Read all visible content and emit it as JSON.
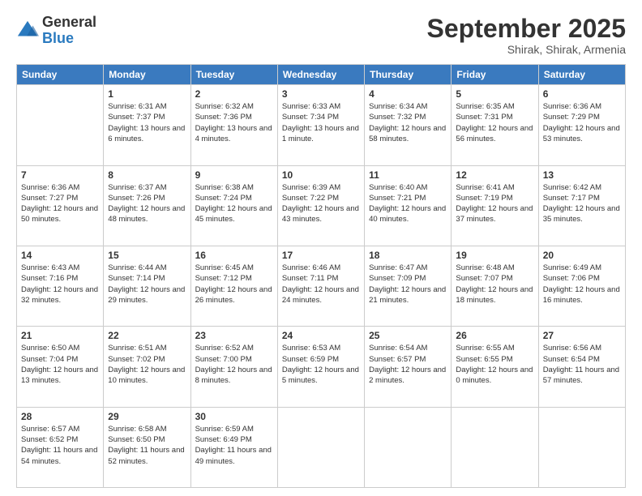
{
  "logo": {
    "general": "General",
    "blue": "Blue"
  },
  "header": {
    "month": "September 2025",
    "location": "Shirak, Shirak, Armenia"
  },
  "weekdays": [
    "Sunday",
    "Monday",
    "Tuesday",
    "Wednesday",
    "Thursday",
    "Friday",
    "Saturday"
  ],
  "weeks": [
    [
      null,
      {
        "day": "1",
        "sunrise": "6:31 AM",
        "sunset": "7:37 PM",
        "daylight": "13 hours and 6 minutes."
      },
      {
        "day": "2",
        "sunrise": "6:32 AM",
        "sunset": "7:36 PM",
        "daylight": "13 hours and 4 minutes."
      },
      {
        "day": "3",
        "sunrise": "6:33 AM",
        "sunset": "7:34 PM",
        "daylight": "13 hours and 1 minute."
      },
      {
        "day": "4",
        "sunrise": "6:34 AM",
        "sunset": "7:32 PM",
        "daylight": "12 hours and 58 minutes."
      },
      {
        "day": "5",
        "sunrise": "6:35 AM",
        "sunset": "7:31 PM",
        "daylight": "12 hours and 56 minutes."
      },
      {
        "day": "6",
        "sunrise": "6:36 AM",
        "sunset": "7:29 PM",
        "daylight": "12 hours and 53 minutes."
      }
    ],
    [
      {
        "day": "7",
        "sunrise": "6:36 AM",
        "sunset": "7:27 PM",
        "daylight": "12 hours and 50 minutes."
      },
      {
        "day": "8",
        "sunrise": "6:37 AM",
        "sunset": "7:26 PM",
        "daylight": "12 hours and 48 minutes."
      },
      {
        "day": "9",
        "sunrise": "6:38 AM",
        "sunset": "7:24 PM",
        "daylight": "12 hours and 45 minutes."
      },
      {
        "day": "10",
        "sunrise": "6:39 AM",
        "sunset": "7:22 PM",
        "daylight": "12 hours and 43 minutes."
      },
      {
        "day": "11",
        "sunrise": "6:40 AM",
        "sunset": "7:21 PM",
        "daylight": "12 hours and 40 minutes."
      },
      {
        "day": "12",
        "sunrise": "6:41 AM",
        "sunset": "7:19 PM",
        "daylight": "12 hours and 37 minutes."
      },
      {
        "day": "13",
        "sunrise": "6:42 AM",
        "sunset": "7:17 PM",
        "daylight": "12 hours and 35 minutes."
      }
    ],
    [
      {
        "day": "14",
        "sunrise": "6:43 AM",
        "sunset": "7:16 PM",
        "daylight": "12 hours and 32 minutes."
      },
      {
        "day": "15",
        "sunrise": "6:44 AM",
        "sunset": "7:14 PM",
        "daylight": "12 hours and 29 minutes."
      },
      {
        "day": "16",
        "sunrise": "6:45 AM",
        "sunset": "7:12 PM",
        "daylight": "12 hours and 26 minutes."
      },
      {
        "day": "17",
        "sunrise": "6:46 AM",
        "sunset": "7:11 PM",
        "daylight": "12 hours and 24 minutes."
      },
      {
        "day": "18",
        "sunrise": "6:47 AM",
        "sunset": "7:09 PM",
        "daylight": "12 hours and 21 minutes."
      },
      {
        "day": "19",
        "sunrise": "6:48 AM",
        "sunset": "7:07 PM",
        "daylight": "12 hours and 18 minutes."
      },
      {
        "day": "20",
        "sunrise": "6:49 AM",
        "sunset": "7:06 PM",
        "daylight": "12 hours and 16 minutes."
      }
    ],
    [
      {
        "day": "21",
        "sunrise": "6:50 AM",
        "sunset": "7:04 PM",
        "daylight": "12 hours and 13 minutes."
      },
      {
        "day": "22",
        "sunrise": "6:51 AM",
        "sunset": "7:02 PM",
        "daylight": "12 hours and 10 minutes."
      },
      {
        "day": "23",
        "sunrise": "6:52 AM",
        "sunset": "7:00 PM",
        "daylight": "12 hours and 8 minutes."
      },
      {
        "day": "24",
        "sunrise": "6:53 AM",
        "sunset": "6:59 PM",
        "daylight": "12 hours and 5 minutes."
      },
      {
        "day": "25",
        "sunrise": "6:54 AM",
        "sunset": "6:57 PM",
        "daylight": "12 hours and 2 minutes."
      },
      {
        "day": "26",
        "sunrise": "6:55 AM",
        "sunset": "6:55 PM",
        "daylight": "12 hours and 0 minutes."
      },
      {
        "day": "27",
        "sunrise": "6:56 AM",
        "sunset": "6:54 PM",
        "daylight": "11 hours and 57 minutes."
      }
    ],
    [
      {
        "day": "28",
        "sunrise": "6:57 AM",
        "sunset": "6:52 PM",
        "daylight": "11 hours and 54 minutes."
      },
      {
        "day": "29",
        "sunrise": "6:58 AM",
        "sunset": "6:50 PM",
        "daylight": "11 hours and 52 minutes."
      },
      {
        "day": "30",
        "sunrise": "6:59 AM",
        "sunset": "6:49 PM",
        "daylight": "11 hours and 49 minutes."
      },
      null,
      null,
      null,
      null
    ]
  ]
}
